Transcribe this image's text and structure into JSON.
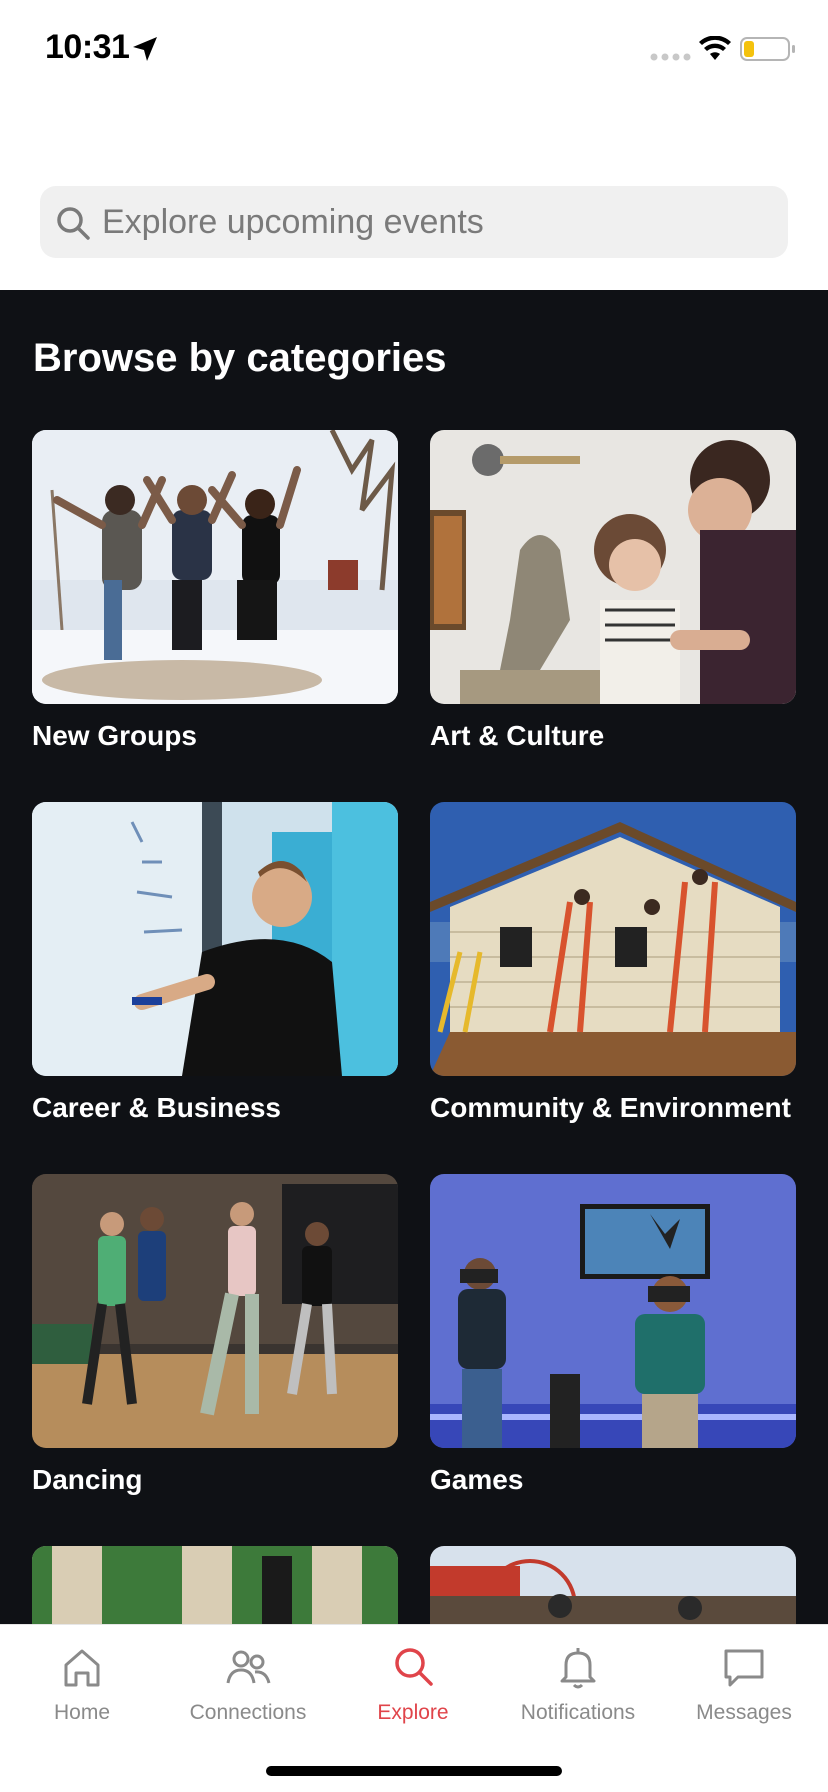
{
  "status_bar": {
    "time": "10:31"
  },
  "search": {
    "placeholder": "Explore upcoming events"
  },
  "section": {
    "title": "Browse by categories"
  },
  "categories": [
    {
      "label": "New Groups",
      "photo": "friends-jumping-in-snow"
    },
    {
      "label": "Art & Culture",
      "photo": "sculpting-class"
    },
    {
      "label": "Career & Business",
      "photo": "whiteboard-presenter"
    },
    {
      "label": "Community & Environment",
      "photo": "painting-a-house"
    },
    {
      "label": "Dancing",
      "photo": "dance-studio"
    },
    {
      "label": "Games",
      "photo": "vr-gaming"
    },
    {
      "label": "",
      "photo": "columns-and-trees"
    },
    {
      "label": "",
      "photo": "boardwalk-ferris-wheel"
    }
  ],
  "tabs": [
    {
      "label": "Home",
      "icon": "house-icon"
    },
    {
      "label": "Connections",
      "icon": "people-icon"
    },
    {
      "label": "Explore",
      "icon": "search-icon",
      "active": true
    },
    {
      "label": "Notifications",
      "icon": "bell-icon"
    },
    {
      "label": "Messages",
      "icon": "chat-bubble-icon"
    }
  ],
  "colors": {
    "accent": "#e0444a",
    "background_dark": "#0f1115",
    "tab_inactive": "#8a8a8a"
  }
}
